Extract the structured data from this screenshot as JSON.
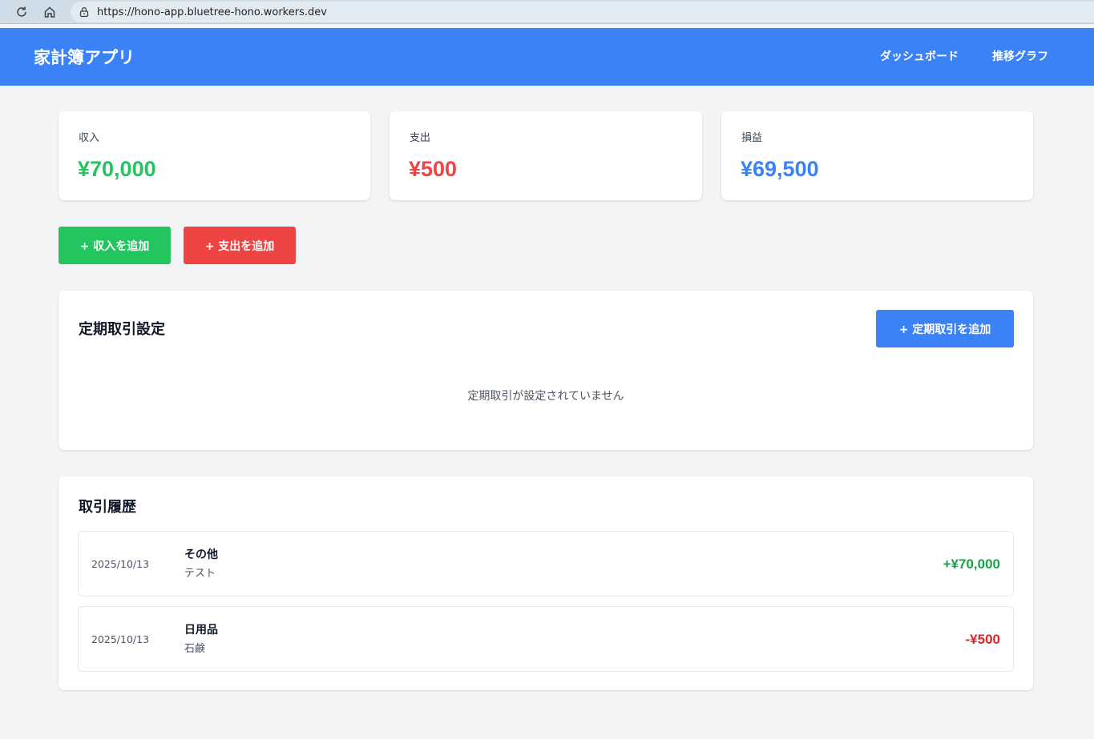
{
  "browser": {
    "url": "https://hono-app.bluetree-hono.workers.dev"
  },
  "header": {
    "title": "家計簿アプリ",
    "nav": [
      {
        "label": "ダッシュボード"
      },
      {
        "label": "推移グラフ"
      }
    ]
  },
  "summary": {
    "income": {
      "label": "収入",
      "value": "¥70,000",
      "color": "#22c55e"
    },
    "expense": {
      "label": "支出",
      "value": "¥500",
      "color": "#ef4444"
    },
    "profit": {
      "label": "損益",
      "value": "¥69,500",
      "color": "#3b82f6"
    }
  },
  "actions": {
    "add_income": "+ 収入を追加",
    "add_expense": "+ 支出を追加"
  },
  "recurring": {
    "title": "定期取引設定",
    "add_button": "+ 定期取引を追加",
    "empty_message": "定期取引が設定されていません"
  },
  "history": {
    "title": "取引履歴",
    "items": [
      {
        "date": "2025/10/13",
        "category": "その他",
        "memo": "テスト",
        "amount": "+¥70,000",
        "color": "#16a34a"
      },
      {
        "date": "2025/10/13",
        "category": "日用品",
        "memo": "石鹸",
        "amount": "-¥500",
        "color": "#dc2626"
      }
    ]
  }
}
